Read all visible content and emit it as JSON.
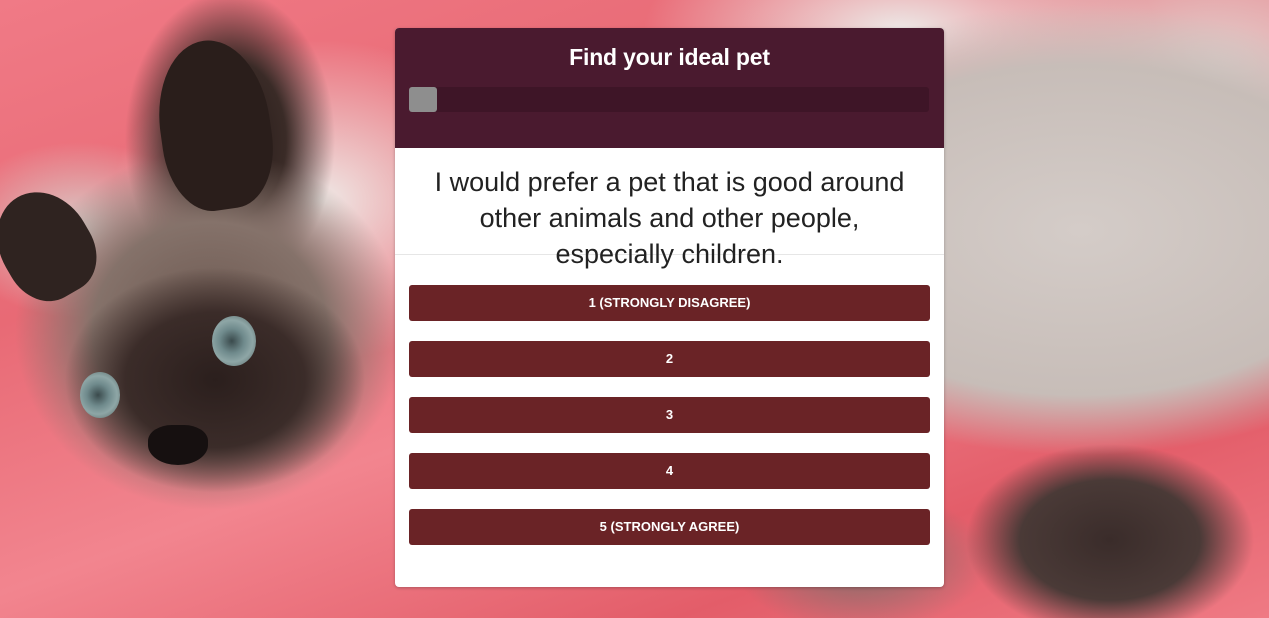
{
  "quiz": {
    "title": "Find your ideal pet",
    "progress": 0.0,
    "question": "I would prefer a pet that is good around other animals and other people, especially children.",
    "answers": [
      "1 (STRONGLY DISAGREE)",
      "2",
      "3",
      "4",
      "5 (STRONGLY AGREE)"
    ]
  },
  "colors": {
    "header": "#4a1a2f",
    "button": "#6a2326",
    "progress_fill": "#8e8e8e"
  },
  "background": {
    "image": "siamese-kitten-on-pink-blanket"
  }
}
